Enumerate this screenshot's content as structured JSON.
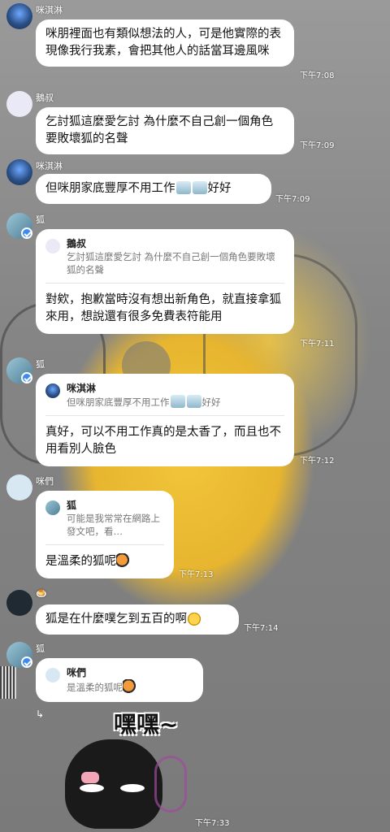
{
  "messages": [
    {
      "sender": "咪淇淋",
      "text": "咪朋裡面也有類似想法的人，可是他實際的表現像我行我素，會把其他人的話當耳邊風咪",
      "time": "下午7:08"
    },
    {
      "sender": "鵝叔",
      "text": "乞討狐這麼愛乞討 為什麼不自己創一個角色 要敗壞狐的名聲",
      "time": "下午7:09"
    },
    {
      "sender": "咪淇淋",
      "text_before": "但咪朋家底豐厚不用工作",
      "text_after": "好好",
      "time": "下午7:09"
    },
    {
      "sender": "狐",
      "quote_name": "鵝叔",
      "quote_text": "乞討狐這麼愛乞討 為什麼不自己創一個角色要敗壞狐的名聲",
      "text": "對欸，抱歉當時沒有想出新角色，就直接拿狐來用，想說還有很多免費表符能用",
      "time": "下午7:11"
    },
    {
      "sender": "狐",
      "quote_name": "咪淇淋",
      "quote_text_before": "但咪朋家底豐厚不用工作",
      "quote_text_after": "好好",
      "text": "真好，可以不用工作真的是太香了，而且也不用看別人臉色",
      "time": "下午7:12"
    },
    {
      "sender": "咪們",
      "quote_name": "狐",
      "quote_text": "可能是我常常在網路上發文吧，看…",
      "text": "是溫柔的狐呢",
      "time": "下午7:13"
    },
    {
      "sender": "🍮",
      "text": "狐是在什麼噗乞到五百的啊",
      "time": "下午7:14"
    },
    {
      "sender": "狐",
      "quote_name": "咪們",
      "quote_text": "是溫柔的狐呢",
      "time": ""
    },
    {
      "sticker_text": "嘿嘿~",
      "time": "下午7:33"
    }
  ],
  "icons": {
    "verified": "verified-badge-icon",
    "reply": "reply-arrow-icon"
  },
  "colors": {
    "bubble": "#ffffff",
    "badge": "#3c8cf0",
    "time_text": "#ffffff"
  }
}
